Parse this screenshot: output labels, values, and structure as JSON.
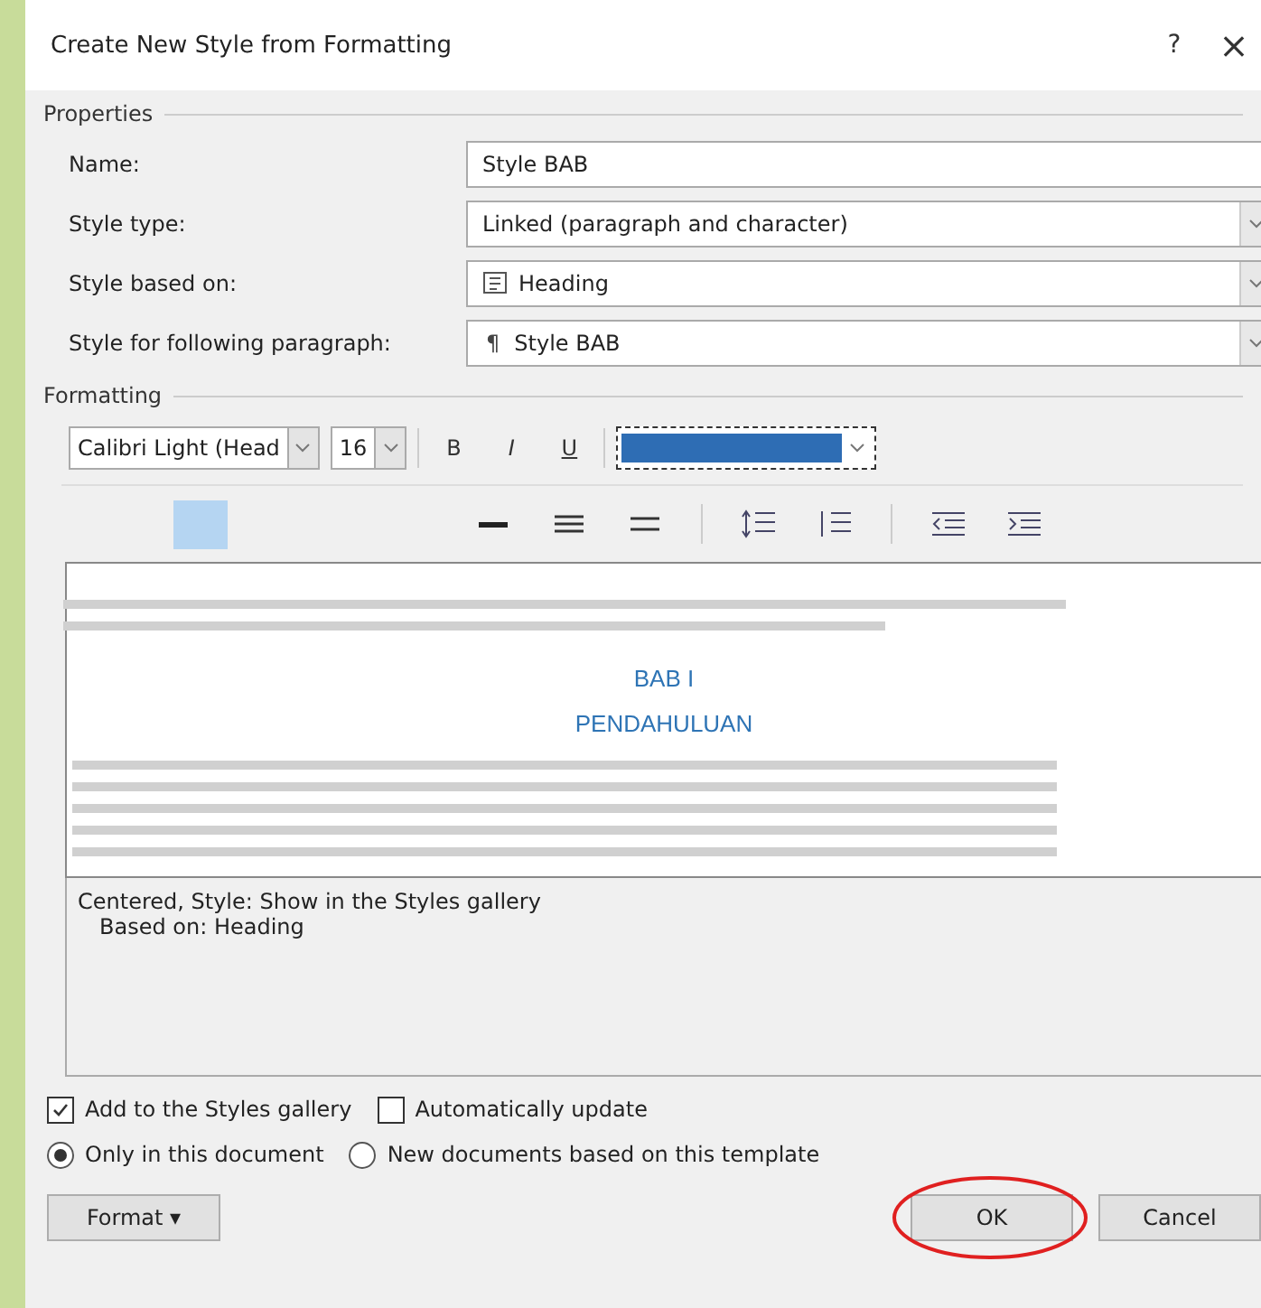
{
  "window": {
    "title": "Create New Style from Formatting",
    "help": "?",
    "close": "×"
  },
  "properties": {
    "legend": "Properties",
    "fields": [
      {
        "label": "Name:",
        "kind": "text",
        "value": "Style BAB"
      },
      {
        "label": "Style type:",
        "kind": "select",
        "value": "Linked (paragraph and character)"
      },
      {
        "label": "Style based on:",
        "kind": "linked-select",
        "value": "Heading"
      },
      {
        "label": "Style for following paragraph:",
        "kind": "paragraph-select",
        "symbol": "¶",
        "value": "Style BAB"
      }
    ]
  },
  "formatting": {
    "legend": "Formatting",
    "font": "Calibri Light (Head",
    "size": "16",
    "bold": "B",
    "italic": "I",
    "underline": "U",
    "color": "#2e6db4"
  },
  "preview": {
    "heading_lines": [
      "BAB I",
      "PENDAHULUAN"
    ]
  },
  "description": [
    "Centered, Style: Show in the Styles gallery",
    "Based on: Heading"
  ],
  "checkboxes": [
    {
      "label": "Add to the Styles gallery",
      "checked": true
    },
    {
      "label": "Automatically update",
      "checked": false
    }
  ],
  "radios": [
    {
      "label": "Only in this document",
      "selected": true
    },
    {
      "label": "New documents based on this template",
      "selected": false
    }
  ],
  "buttons": [
    {
      "label": "Format ▾",
      "kind": "menu"
    },
    {
      "label": "OK",
      "kind": "ok",
      "circled": true
    },
    {
      "label": "Cancel",
      "kind": "cancel"
    }
  ]
}
